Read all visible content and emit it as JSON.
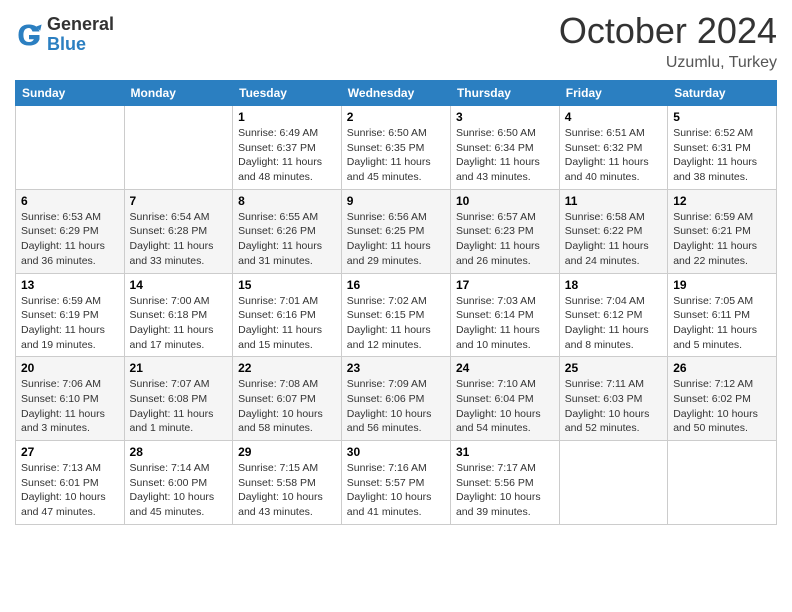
{
  "logo": {
    "general": "General",
    "blue": "Blue"
  },
  "header": {
    "month": "October 2024",
    "location": "Uzumlu, Turkey"
  },
  "weekdays": [
    "Sunday",
    "Monday",
    "Tuesday",
    "Wednesday",
    "Thursday",
    "Friday",
    "Saturday"
  ],
  "weeks": [
    [
      null,
      null,
      {
        "day": "1",
        "sunrise": "6:49 AM",
        "sunset": "6:37 PM",
        "daylight": "11 hours and 48 minutes."
      },
      {
        "day": "2",
        "sunrise": "6:50 AM",
        "sunset": "6:35 PM",
        "daylight": "11 hours and 45 minutes."
      },
      {
        "day": "3",
        "sunrise": "6:50 AM",
        "sunset": "6:34 PM",
        "daylight": "11 hours and 43 minutes."
      },
      {
        "day": "4",
        "sunrise": "6:51 AM",
        "sunset": "6:32 PM",
        "daylight": "11 hours and 40 minutes."
      },
      {
        "day": "5",
        "sunrise": "6:52 AM",
        "sunset": "6:31 PM",
        "daylight": "11 hours and 38 minutes."
      }
    ],
    [
      {
        "day": "6",
        "sunrise": "6:53 AM",
        "sunset": "6:29 PM",
        "daylight": "11 hours and 36 minutes."
      },
      {
        "day": "7",
        "sunrise": "6:54 AM",
        "sunset": "6:28 PM",
        "daylight": "11 hours and 33 minutes."
      },
      {
        "day": "8",
        "sunrise": "6:55 AM",
        "sunset": "6:26 PM",
        "daylight": "11 hours and 31 minutes."
      },
      {
        "day": "9",
        "sunrise": "6:56 AM",
        "sunset": "6:25 PM",
        "daylight": "11 hours and 29 minutes."
      },
      {
        "day": "10",
        "sunrise": "6:57 AM",
        "sunset": "6:23 PM",
        "daylight": "11 hours and 26 minutes."
      },
      {
        "day": "11",
        "sunrise": "6:58 AM",
        "sunset": "6:22 PM",
        "daylight": "11 hours and 24 minutes."
      },
      {
        "day": "12",
        "sunrise": "6:59 AM",
        "sunset": "6:21 PM",
        "daylight": "11 hours and 22 minutes."
      }
    ],
    [
      {
        "day": "13",
        "sunrise": "6:59 AM",
        "sunset": "6:19 PM",
        "daylight": "11 hours and 19 minutes."
      },
      {
        "day": "14",
        "sunrise": "7:00 AM",
        "sunset": "6:18 PM",
        "daylight": "11 hours and 17 minutes."
      },
      {
        "day": "15",
        "sunrise": "7:01 AM",
        "sunset": "6:16 PM",
        "daylight": "11 hours and 15 minutes."
      },
      {
        "day": "16",
        "sunrise": "7:02 AM",
        "sunset": "6:15 PM",
        "daylight": "11 hours and 12 minutes."
      },
      {
        "day": "17",
        "sunrise": "7:03 AM",
        "sunset": "6:14 PM",
        "daylight": "11 hours and 10 minutes."
      },
      {
        "day": "18",
        "sunrise": "7:04 AM",
        "sunset": "6:12 PM",
        "daylight": "11 hours and 8 minutes."
      },
      {
        "day": "19",
        "sunrise": "7:05 AM",
        "sunset": "6:11 PM",
        "daylight": "11 hours and 5 minutes."
      }
    ],
    [
      {
        "day": "20",
        "sunrise": "7:06 AM",
        "sunset": "6:10 PM",
        "daylight": "11 hours and 3 minutes."
      },
      {
        "day": "21",
        "sunrise": "7:07 AM",
        "sunset": "6:08 PM",
        "daylight": "11 hours and 1 minute."
      },
      {
        "day": "22",
        "sunrise": "7:08 AM",
        "sunset": "6:07 PM",
        "daylight": "10 hours and 58 minutes."
      },
      {
        "day": "23",
        "sunrise": "7:09 AM",
        "sunset": "6:06 PM",
        "daylight": "10 hours and 56 minutes."
      },
      {
        "day": "24",
        "sunrise": "7:10 AM",
        "sunset": "6:04 PM",
        "daylight": "10 hours and 54 minutes."
      },
      {
        "day": "25",
        "sunrise": "7:11 AM",
        "sunset": "6:03 PM",
        "daylight": "10 hours and 52 minutes."
      },
      {
        "day": "26",
        "sunrise": "7:12 AM",
        "sunset": "6:02 PM",
        "daylight": "10 hours and 50 minutes."
      }
    ],
    [
      {
        "day": "27",
        "sunrise": "7:13 AM",
        "sunset": "6:01 PM",
        "daylight": "10 hours and 47 minutes."
      },
      {
        "day": "28",
        "sunrise": "7:14 AM",
        "sunset": "6:00 PM",
        "daylight": "10 hours and 45 minutes."
      },
      {
        "day": "29",
        "sunrise": "7:15 AM",
        "sunset": "5:58 PM",
        "daylight": "10 hours and 43 minutes."
      },
      {
        "day": "30",
        "sunrise": "7:16 AM",
        "sunset": "5:57 PM",
        "daylight": "10 hours and 41 minutes."
      },
      {
        "day": "31",
        "sunrise": "7:17 AM",
        "sunset": "5:56 PM",
        "daylight": "10 hours and 39 minutes."
      },
      null,
      null
    ]
  ]
}
